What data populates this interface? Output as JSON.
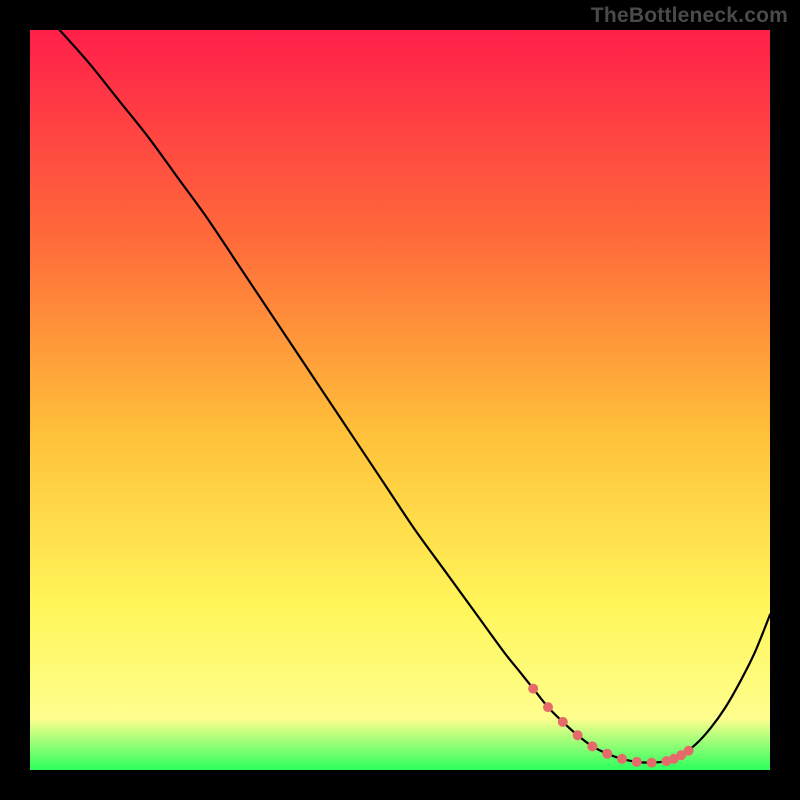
{
  "watermark": "TheBottleneck.com",
  "colors": {
    "frame": "#000000",
    "curve_stroke": "#000000",
    "marker_fill": "#e66a6a",
    "gradient_top": "#ff1f4a",
    "gradient_mid_upper": "#ff6a3a",
    "gradient_mid": "#ffc23a",
    "gradient_mid_lower": "#fff65a",
    "gradient_bottom_yellow": "#fffe8e",
    "gradient_bottom_green": "#2cff5e"
  },
  "chart_data": {
    "type": "line",
    "title": "",
    "xlabel": "",
    "ylabel": "",
    "xlim": [
      0,
      100
    ],
    "ylim": [
      0,
      100
    ],
    "grid": false,
    "x": [
      4,
      8,
      12,
      16,
      20,
      24,
      28,
      32,
      36,
      40,
      44,
      48,
      52,
      56,
      60,
      64,
      66,
      68,
      70,
      72,
      74,
      76,
      78,
      80,
      82,
      84,
      86,
      88,
      90,
      92,
      94,
      96,
      98,
      100
    ],
    "values": [
      100,
      95.5,
      90.5,
      85.5,
      80,
      74.5,
      68.5,
      62.5,
      56.5,
      50.5,
      44.5,
      38.5,
      32.5,
      27,
      21.5,
      16,
      13.5,
      11,
      8.5,
      6.5,
      4.7,
      3.2,
      2.2,
      1.5,
      1.1,
      1.0,
      1.2,
      2.0,
      3.5,
      5.7,
      8.5,
      12,
      16,
      21
    ],
    "markers": {
      "x": [
        68,
        70,
        72,
        74,
        76,
        78,
        80,
        82,
        84,
        86,
        87,
        88,
        89
      ],
      "y": [
        11,
        8.5,
        6.5,
        4.7,
        3.2,
        2.2,
        1.5,
        1.1,
        1.0,
        1.2,
        1.5,
        2.0,
        2.6
      ]
    }
  }
}
